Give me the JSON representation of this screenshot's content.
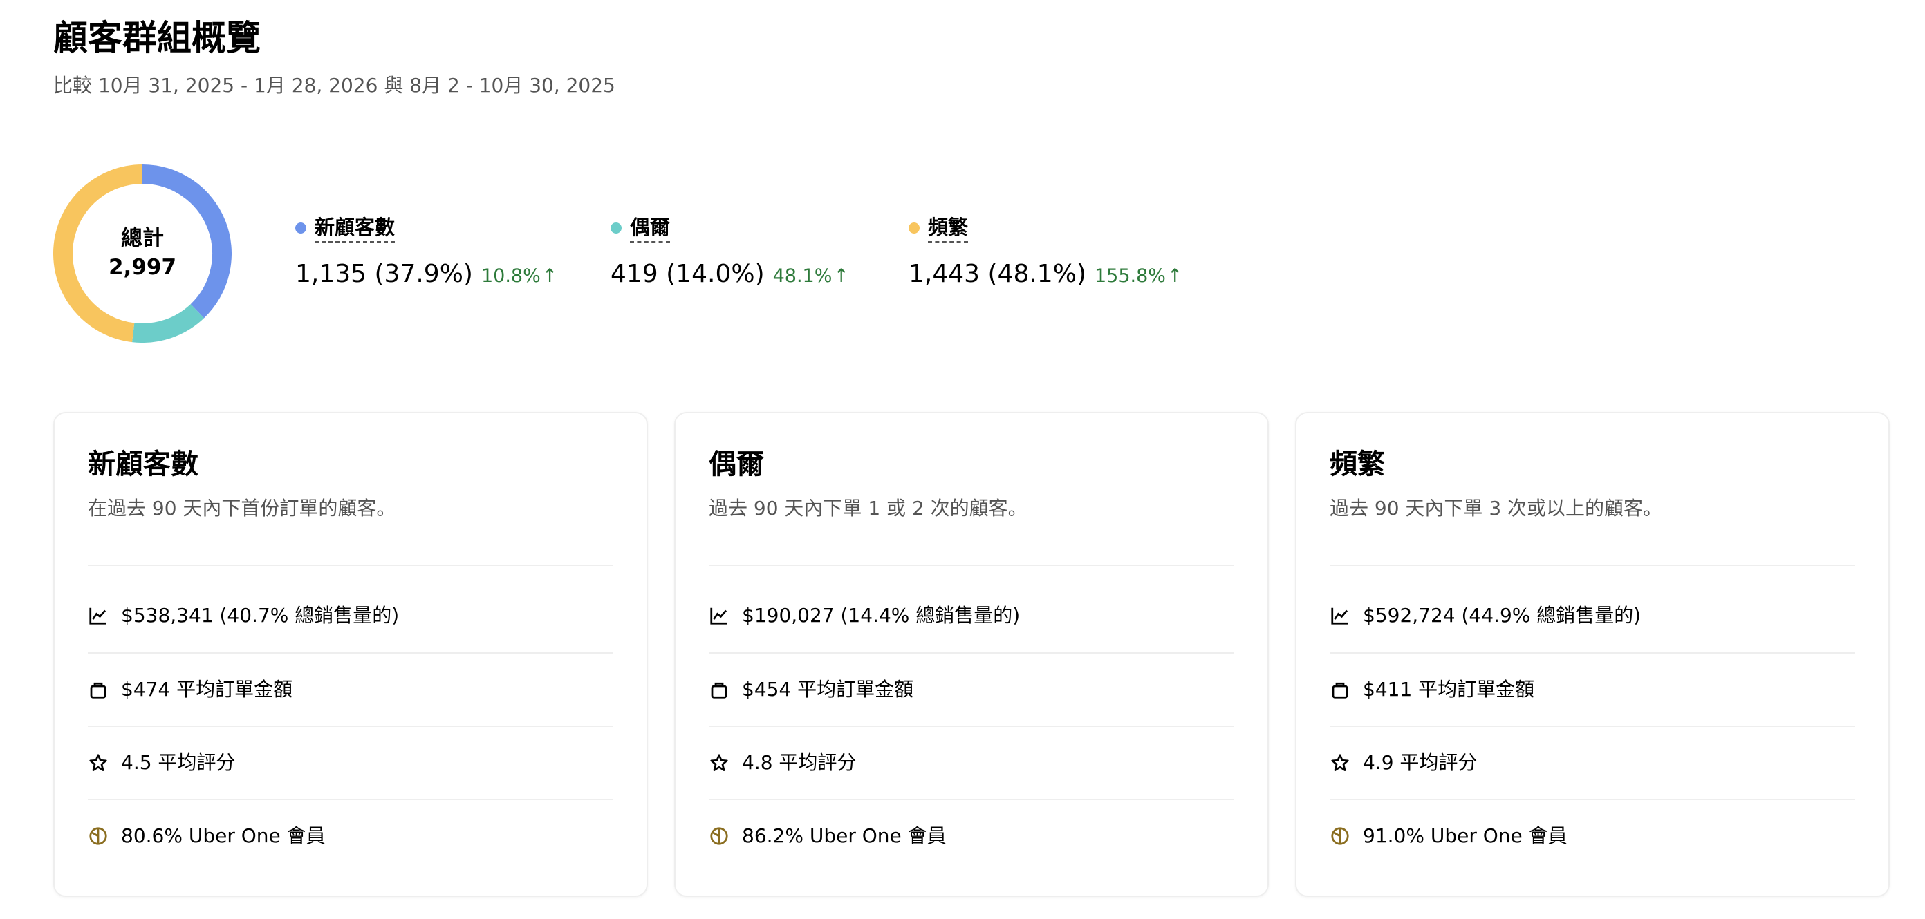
{
  "header": {
    "title": "顧客群組概覽",
    "subtitle": "比較 10月 31, 2025 - 1月 28, 2026 與 8月 2 - 10月 30, 2025"
  },
  "summary": {
    "total_label": "總計",
    "total_value": "2,997",
    "segments": [
      {
        "name": "新顧客數",
        "value_text": "1,135 (37.9%)",
        "change": "10.8%",
        "color": "#6d93eb",
        "count": 1135
      },
      {
        "name": "偶爾",
        "value_text": "419 (14.0%)",
        "change": "48.1%",
        "color": "#6ccdc9",
        "count": 419
      },
      {
        "name": "頻繁",
        "value_text": "1,443 (48.1%)",
        "change": "155.8%",
        "color": "#f8c55e",
        "count": 1443
      }
    ],
    "arrow_icon": "arrow-up-icon"
  },
  "cards": [
    {
      "title": "新顧客數",
      "description": "在過去 90 天內下首份訂單的顧客。",
      "metrics": [
        {
          "icon": "line-chart-icon",
          "text": "$538,341 (40.7% 總銷售量的)"
        },
        {
          "icon": "bag-icon",
          "text": "$474 平均訂單金額"
        },
        {
          "icon": "star-icon",
          "text": "4.5 平均評分"
        },
        {
          "icon": "uber-one-icon",
          "text": "80.6% Uber One 會員"
        }
      ]
    },
    {
      "title": "偶爾",
      "description": "過去 90 天內下單 1 或 2 次的顧客。",
      "metrics": [
        {
          "icon": "line-chart-icon",
          "text": "$190,027 (14.4% 總銷售量的)"
        },
        {
          "icon": "bag-icon",
          "text": "$454 平均訂單金額"
        },
        {
          "icon": "star-icon",
          "text": "4.8 平均評分"
        },
        {
          "icon": "uber-one-icon",
          "text": "86.2% Uber One 會員"
        }
      ]
    },
    {
      "title": "頻繁",
      "description": "過去 90 天內下單 3 次或以上的顧客。",
      "metrics": [
        {
          "icon": "line-chart-icon",
          "text": "$592,724 (44.9% 總銷售量的)"
        },
        {
          "icon": "bag-icon",
          "text": "$411 平均訂單金額"
        },
        {
          "icon": "star-icon",
          "text": "4.9 平均評分"
        },
        {
          "icon": "uber-one-icon",
          "text": "91.0% Uber One 會員"
        }
      ]
    }
  ],
  "colors": {
    "positive_change": "#2d7a3a",
    "uber_one_gold": "#8a6d1f"
  }
}
